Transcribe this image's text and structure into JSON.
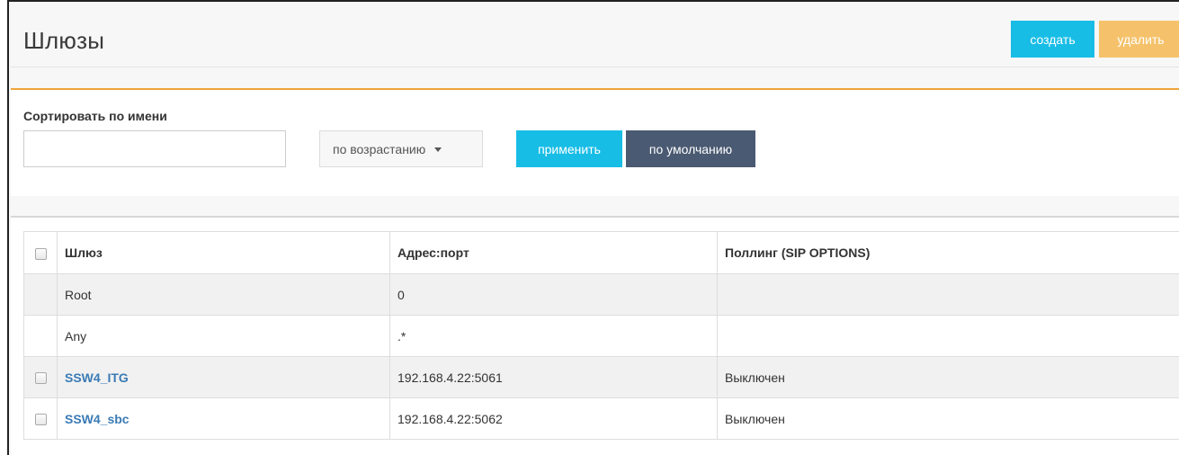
{
  "header": {
    "title": "Шлюзы",
    "create_label": "создать",
    "delete_label": "удалить"
  },
  "filter": {
    "label": "Сортировать по имени",
    "name_value": "",
    "sort_selected": "по возрастанию",
    "apply_label": "применить",
    "default_label": "по умолчанию"
  },
  "table": {
    "headers": [
      "Шлюз",
      "Адрес:порт",
      "Поллинг (SIP OPTIONS)"
    ],
    "rows": [
      {
        "name": "Root",
        "address": "0",
        "polling": ""
      },
      {
        "name": "Any",
        "address": ".*",
        "polling": ""
      },
      {
        "name": "SSW4_ITG",
        "address": "192.168.4.22:5061",
        "polling": "Выключен"
      },
      {
        "name": "SSW4_sbc",
        "address": "192.168.4.22:5062",
        "polling": "Выключен"
      }
    ]
  },
  "colors": {
    "accent_cyan": "#18bde6",
    "delete_orange": "#f5c26b",
    "default_slate": "#4a5a72",
    "divider_orange": "#f0a43a",
    "link_blue": "#3a7bb5"
  }
}
